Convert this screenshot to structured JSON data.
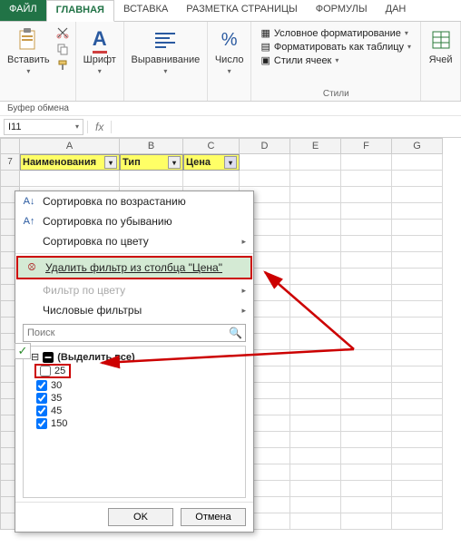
{
  "tabs": {
    "file": "ФАЙЛ",
    "home": "ГЛАВНАЯ",
    "insert": "ВСТАВКА",
    "pagelayout": "РАЗМЕТКА СТРАНИЦЫ",
    "formulas": "ФОРМУЛЫ",
    "data": "ДАН"
  },
  "ribbon": {
    "clipboard": {
      "paste": "Вставить",
      "group": "Буфер обмена"
    },
    "font": {
      "label": "Шрифт"
    },
    "align": {
      "label": "Выравнивание"
    },
    "number": {
      "label": "Число"
    },
    "styles": {
      "cond": "Условное форматирование",
      "table": "Форматировать как таблицу",
      "cell": "Стили ячеек",
      "group": "Стили"
    },
    "cells": {
      "label": "Ячей"
    }
  },
  "namebox": "I11",
  "fx_symbol": "fx",
  "columns": [
    "A",
    "B",
    "C",
    "D",
    "E",
    "F",
    "G"
  ],
  "row_first": "7",
  "header_row": {
    "A": "Наименования",
    "B": "Тип",
    "C": "Цена"
  },
  "filter": {
    "sort_asc": "Сортировка по возрастанию",
    "sort_desc": "Сортировка по убыванию",
    "sort_color": "Сортировка по цвету",
    "clear": "Удалить фильтр из столбца \"Цена\"",
    "filter_color": "Фильтр по цвету",
    "num_filters": "Числовые фильтры",
    "search_ph": "Поиск",
    "select_all": "(Выделить все)",
    "values": [
      {
        "label": "25",
        "checked": false,
        "boxed": true
      },
      {
        "label": "30",
        "checked": true
      },
      {
        "label": "35",
        "checked": true
      },
      {
        "label": "45",
        "checked": true
      },
      {
        "label": "150",
        "checked": true
      }
    ],
    "ok": "OK",
    "cancel": "Отмена"
  }
}
